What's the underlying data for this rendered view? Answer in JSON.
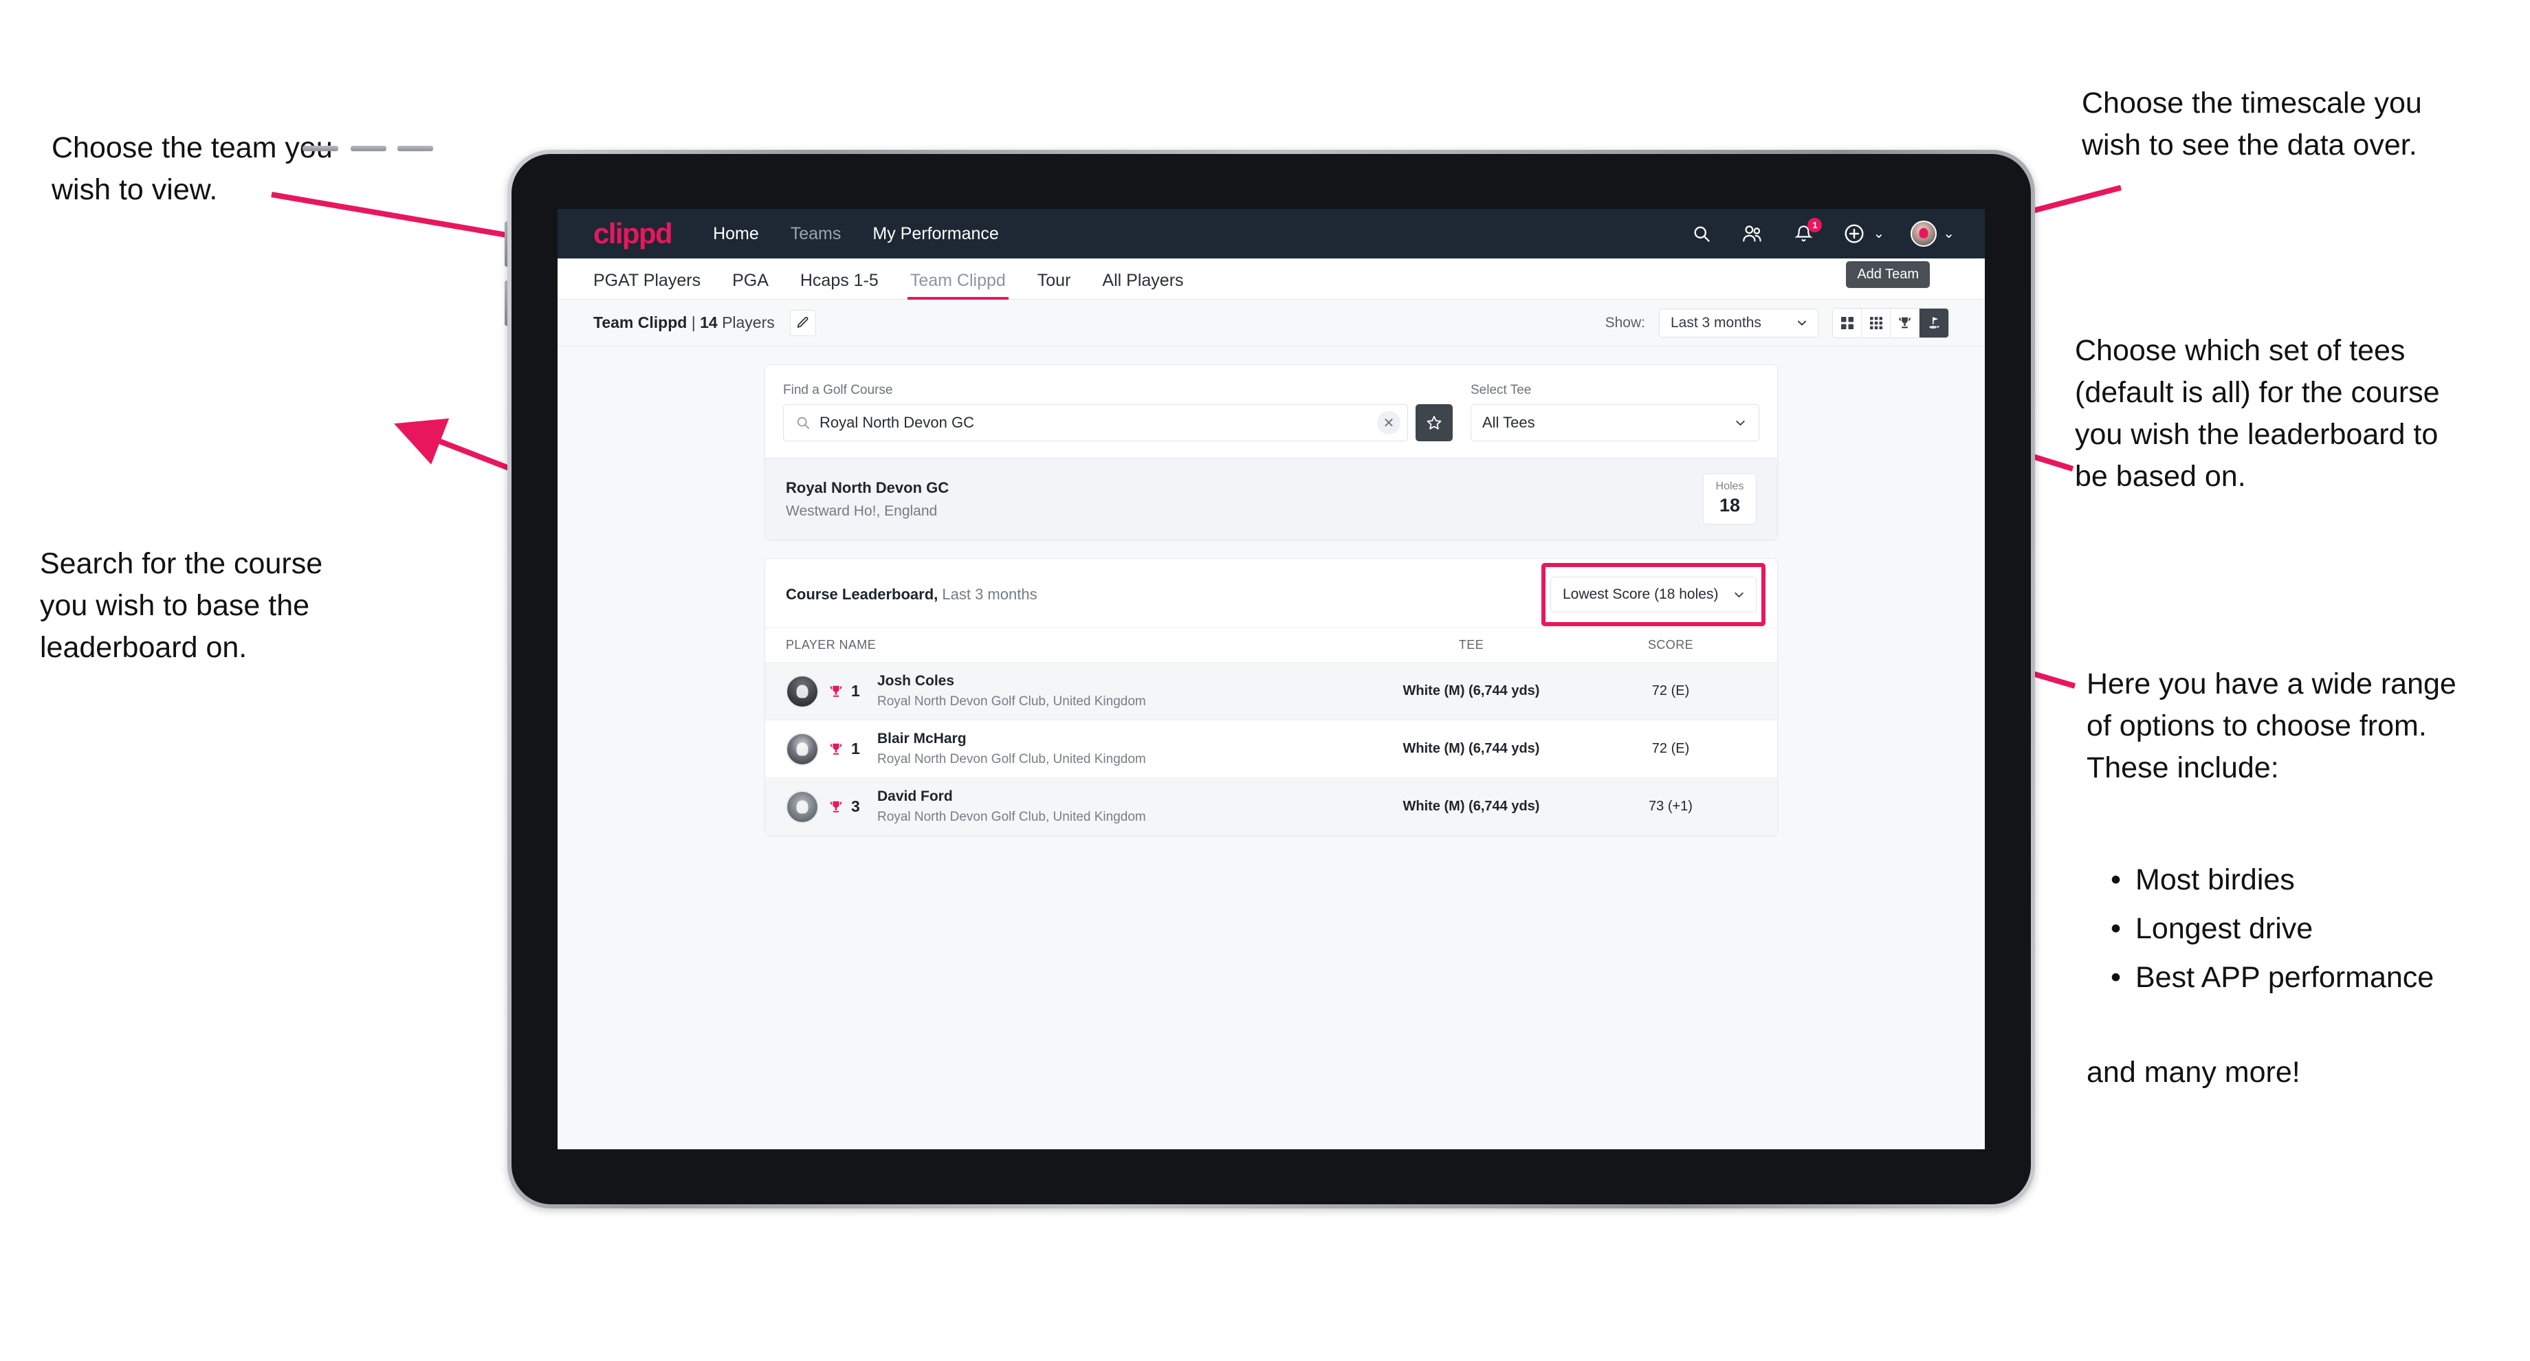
{
  "annotations": {
    "team": "Choose the team you\nwish to view.",
    "search": "Search for the course\nyou wish to base the\nleaderboard on.",
    "timescale": "Choose the timescale you\nwish to see the data over.",
    "tees": "Choose which set of tees\n(default is all) for the course\nyou wish the leaderboard to\nbe based on.",
    "options_intro": "Here you have a wide range\nof options to choose from.\nThese include:",
    "options_list": [
      "Most birdies",
      "Longest drive",
      "Best APP performance"
    ],
    "options_outro": "and many more!"
  },
  "app": {
    "logo": "clippd",
    "nav_links": [
      {
        "label": "Home",
        "active": true
      },
      {
        "label": "Teams",
        "active": false
      },
      {
        "label": "My Performance",
        "active": true
      }
    ],
    "nav_icons": [
      "search-icon",
      "people-icon",
      "notifications-icon",
      "add-icon",
      "profile-icon"
    ],
    "notification_count": "1",
    "tooltip": "Add Team",
    "tabs": [
      {
        "label": "PGAT Players",
        "active": false
      },
      {
        "label": "PGA",
        "active": false
      },
      {
        "label": "Hcaps 1-5",
        "active": false
      },
      {
        "label": "Team Clippd",
        "active": true
      },
      {
        "label": "Tour",
        "active": false
      },
      {
        "label": "All Players",
        "active": false
      }
    ],
    "toolbar": {
      "team_name": "Team Clippd",
      "separator": "|",
      "player_count": "14",
      "players_word": "Players",
      "edit_icon": "pencil-icon",
      "show_label": "Show:",
      "period_value": "Last 3 months",
      "view_modes": [
        "grid-4-icon",
        "grid-9-icon",
        "trophy-icon",
        "golf-flag-icon"
      ],
      "active_view": "golf-flag-icon"
    },
    "search_card": {
      "course_label": "Find a Golf Course",
      "course_value": "Royal North Devon GC",
      "course_placeholder": "Find a Golf Course",
      "clear_icon": "close-icon",
      "favorite_icon": "star-icon",
      "tee_label": "Select Tee",
      "tee_value": "All Tees"
    },
    "course_result": {
      "name": "Royal North Devon GC",
      "location": "Westward Ho!, England",
      "holes_label": "Holes",
      "holes_value": "18"
    },
    "leaderboard": {
      "title": "Course Leaderboard,",
      "subtitle": " Last 3 months",
      "metric_value": "Lowest Score (18 holes)",
      "columns": [
        "PLAYER NAME",
        "TEE",
        "SCORE"
      ],
      "rows": [
        {
          "rank": "1",
          "name": "Josh Coles",
          "club": "Royal North Devon Golf Club, United Kingdom",
          "tee": "White (M) (6,744 yds)",
          "score": "72 (E)"
        },
        {
          "rank": "1",
          "name": "Blair McHarg",
          "club": "Royal North Devon Golf Club, United Kingdom",
          "tee": "White (M) (6,744 yds)",
          "score": "72 (E)"
        },
        {
          "rank": "3",
          "name": "David Ford",
          "club": "Royal North Devon Golf Club, United Kingdom",
          "tee": "White (M) (6,744 yds)",
          "score": "73 (+1)"
        }
      ]
    }
  },
  "colors": {
    "accent": "#e8175d",
    "navbar": "#1d2834",
    "page_bg": "#f7f8fa"
  }
}
